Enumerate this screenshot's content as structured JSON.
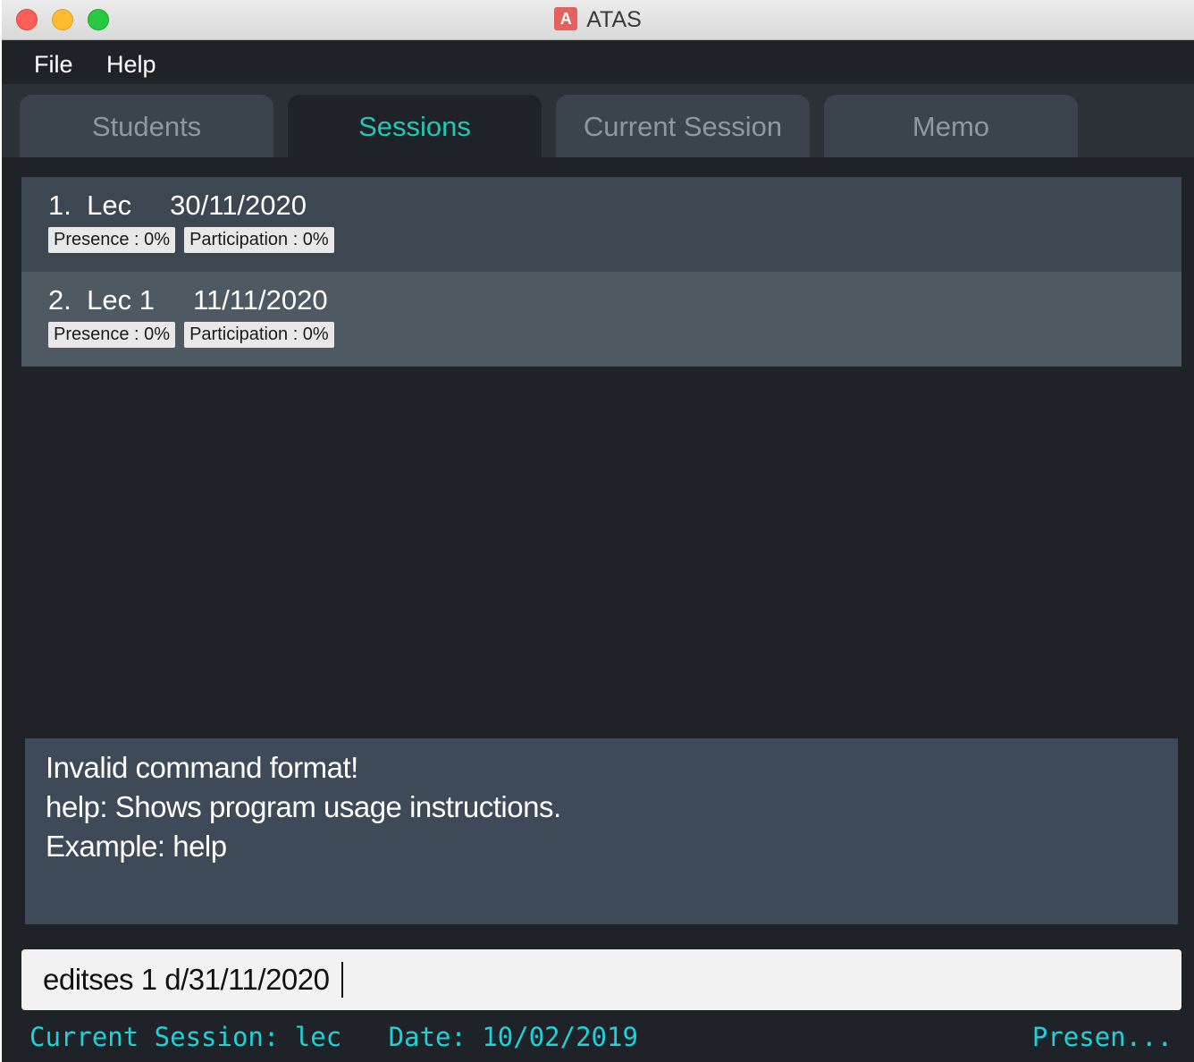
{
  "window": {
    "title": "ATAS",
    "icon_letter": "A"
  },
  "menubar": {
    "items": [
      "File",
      "Help"
    ]
  },
  "tabs": [
    {
      "label": "Students",
      "active": false
    },
    {
      "label": "Sessions",
      "active": true
    },
    {
      "label": "Current Session",
      "active": false
    },
    {
      "label": "Memo",
      "active": false
    }
  ],
  "sessions": [
    {
      "index": "1.",
      "name": "Lec",
      "date": "30/11/2020",
      "presence": "Presence : 0%",
      "participation": "Participation : 0%"
    },
    {
      "index": "2.",
      "name": "Lec 1",
      "date": "11/11/2020",
      "presence": "Presence : 0%",
      "participation": "Participation : 0%"
    }
  ],
  "result": {
    "lines": [
      "Invalid command format!",
      "help: Shows program usage instructions.",
      "Example: help"
    ]
  },
  "command": {
    "value": "editses 1 d/31/11/2020"
  },
  "status": {
    "left": "Current Session: lec   Date: 10/02/2019",
    "right": "Presen..."
  },
  "colors": {
    "accent": "#22c8b4",
    "status_text": "#1fd1d9",
    "background": "#1f2328"
  }
}
